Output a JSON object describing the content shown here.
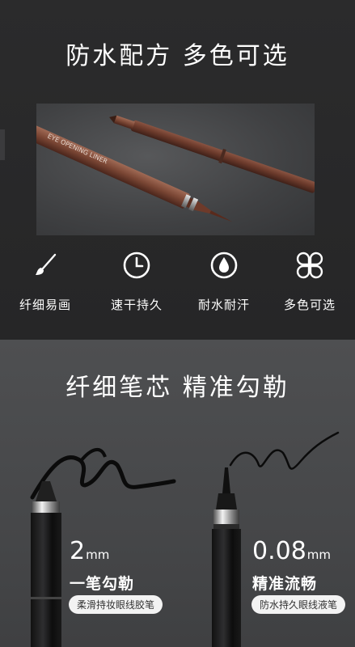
{
  "section1": {
    "title": "防水配方 多色可选",
    "photo_text": "EYE OPENING LINER",
    "features": [
      {
        "icon": "brush-icon",
        "label": "纤细易画"
      },
      {
        "icon": "clock-icon",
        "label": "速干持久"
      },
      {
        "icon": "water-drop-icon",
        "label": "耐水耐汗"
      },
      {
        "icon": "clover-icon",
        "label": "多色可选"
      }
    ]
  },
  "section2": {
    "title": "纤细笔芯 精准勾勒",
    "left": {
      "size": "2",
      "unit": "mm",
      "desc": "一笔勾勒",
      "tag": "柔滑持妆眼线胶笔"
    },
    "right": {
      "size": "0.08",
      "unit": "mm",
      "desc": "精准流畅",
      "tag": "防水持久眼线液笔"
    }
  },
  "colors": {
    "top_bg": "#2b2b2c",
    "bottom_bg": "#4e4f51",
    "pen_brown": "#6b3d2e",
    "text": "#ffffff"
  }
}
